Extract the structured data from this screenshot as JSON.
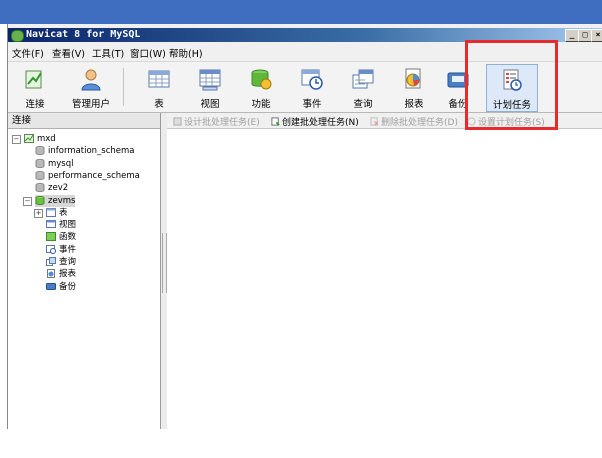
{
  "window": {
    "title": "Navicat 8 for MySQL"
  },
  "menu": [
    "文件(F)",
    "查看(V)",
    "工具(T)",
    "窗口(W)",
    "帮助(H)"
  ],
  "toolbar": [
    {
      "label": "连接",
      "icon": "connect-icon"
    },
    {
      "label": "管理用户",
      "icon": "user-icon"
    },
    {
      "label": "表",
      "icon": "table-icon"
    },
    {
      "label": "视图",
      "icon": "view-icon"
    },
    {
      "label": "功能",
      "icon": "function-icon"
    },
    {
      "label": "事件",
      "icon": "event-icon"
    },
    {
      "label": "查询",
      "icon": "query-icon"
    },
    {
      "label": "报表",
      "icon": "report-icon"
    },
    {
      "label": "备份",
      "icon": "backup-icon"
    },
    {
      "label": "计划任务",
      "icon": "schedule-icon"
    }
  ],
  "sidebar": {
    "header": "连接",
    "tree": [
      {
        "label": "mxd",
        "level": 0,
        "toggle": "-",
        "icon": "connection-icon"
      },
      {
        "label": "information_schema",
        "level": 1,
        "icon": "database-icon"
      },
      {
        "label": "mysql",
        "level": 1,
        "icon": "database-icon"
      },
      {
        "label": "performance_schema",
        "level": 1,
        "icon": "database-icon"
      },
      {
        "label": "zev2",
        "level": 1,
        "icon": "database-icon"
      },
      {
        "label": "zevms",
        "level": 1,
        "toggle": "-",
        "icon": "database-open-icon",
        "selected": true
      },
      {
        "label": "表",
        "level": 2,
        "toggle": "+",
        "icon": "table-icon"
      },
      {
        "label": "视图",
        "level": 2,
        "icon": "view-icon"
      },
      {
        "label": "函数",
        "level": 2,
        "icon": "function-icon"
      },
      {
        "label": "事件",
        "level": 2,
        "icon": "event-icon"
      },
      {
        "label": "查询",
        "level": 2,
        "icon": "query-icon"
      },
      {
        "label": "报表",
        "level": 2,
        "icon": "report-icon"
      },
      {
        "label": "备份",
        "level": 2,
        "icon": "backup-icon"
      }
    ]
  },
  "subtoolbar": [
    {
      "label": "设计批处理任务(E)",
      "enabled": false,
      "icon": "design-icon"
    },
    {
      "label": "创建批处理任务(N)",
      "enabled": true,
      "icon": "create-icon"
    },
    {
      "label": "删除批处理任务(D)",
      "enabled": false,
      "icon": "delete-icon"
    },
    {
      "label": "设置计划任务(S)",
      "enabled": false,
      "icon": "schedule-set-icon"
    }
  ],
  "colors": {
    "highlight_frame": "#e82a2a",
    "title_bar": "#0a246a",
    "desktop": "#3f6ec1"
  }
}
